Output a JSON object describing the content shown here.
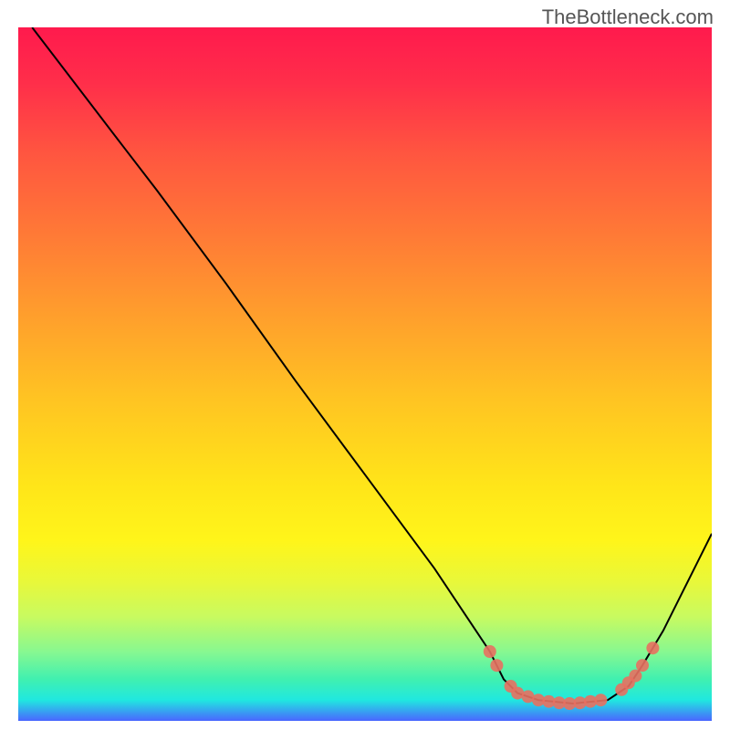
{
  "watermark": "TheBottleneck.com",
  "chart_data": {
    "type": "line",
    "title": "",
    "xlabel": "",
    "ylabel": "",
    "xlim": [
      0,
      100
    ],
    "ylim": [
      0,
      100
    ],
    "grid": false,
    "curve": [
      {
        "x": 2,
        "y": 100
      },
      {
        "x": 15,
        "y": 83
      },
      {
        "x": 20,
        "y": 76.5
      },
      {
        "x": 30,
        "y": 63
      },
      {
        "x": 40,
        "y": 49
      },
      {
        "x": 50,
        "y": 35.5
      },
      {
        "x": 60,
        "y": 22
      },
      {
        "x": 66,
        "y": 13
      },
      {
        "x": 68,
        "y": 10
      },
      {
        "x": 70,
        "y": 6
      },
      {
        "x": 72,
        "y": 4
      },
      {
        "x": 75,
        "y": 3
      },
      {
        "x": 80,
        "y": 2.5
      },
      {
        "x": 85,
        "y": 3
      },
      {
        "x": 88,
        "y": 5
      },
      {
        "x": 90,
        "y": 8
      },
      {
        "x": 93,
        "y": 13
      },
      {
        "x": 96,
        "y": 19
      },
      {
        "x": 100,
        "y": 27
      }
    ],
    "dots": [
      {
        "x": 68,
        "y": 10
      },
      {
        "x": 69,
        "y": 8
      },
      {
        "x": 71,
        "y": 5
      },
      {
        "x": 72,
        "y": 4
      },
      {
        "x": 73.5,
        "y": 3.5
      },
      {
        "x": 75,
        "y": 3
      },
      {
        "x": 76.5,
        "y": 2.8
      },
      {
        "x": 78,
        "y": 2.6
      },
      {
        "x": 79.5,
        "y": 2.5
      },
      {
        "x": 81,
        "y": 2.6
      },
      {
        "x": 82.5,
        "y": 2.8
      },
      {
        "x": 84,
        "y": 3
      },
      {
        "x": 87,
        "y": 4.5
      },
      {
        "x": 88,
        "y": 5.5
      },
      {
        "x": 89,
        "y": 6.5
      },
      {
        "x": 90,
        "y": 8
      },
      {
        "x": 91.5,
        "y": 10.5
      }
    ]
  }
}
